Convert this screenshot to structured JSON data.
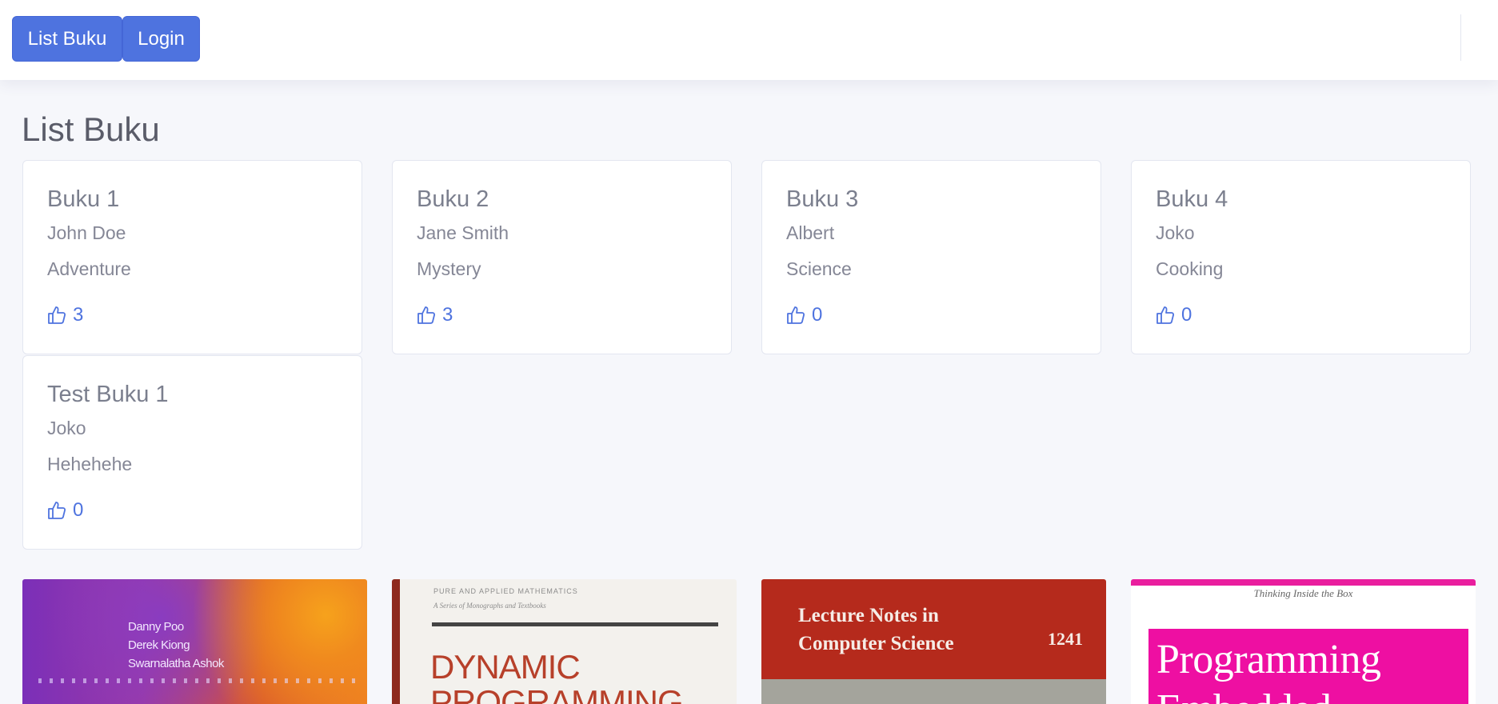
{
  "navbar": {
    "list_buku_label": "List Buku",
    "login_label": "Login"
  },
  "page": {
    "title": "List Buku"
  },
  "books": [
    {
      "title": "Buku 1",
      "author": "John Doe",
      "genre": "Adventure",
      "likes": "3"
    },
    {
      "title": "Buku 2",
      "author": "Jane Smith",
      "genre": "Mystery",
      "likes": "3"
    },
    {
      "title": "Buku 3",
      "author": "Albert",
      "genre": "Science",
      "likes": "0"
    },
    {
      "title": "Buku 4",
      "author": "Joko",
      "genre": "Cooking",
      "likes": "0"
    },
    {
      "title": "Test Buku 1",
      "author": "Joko",
      "genre": "Hehehehe",
      "likes": "0"
    }
  ],
  "covers": [
    {
      "authors": [
        "Danny Poo",
        "Derek Kiong",
        "Swarnalatha Ashok"
      ]
    },
    {
      "series_line": "PURE AND APPLIED MATHEMATICS",
      "subtitle": "A Series of Monographs and Textbooks",
      "title": "DYNAMIC PROGRAMMING"
    },
    {
      "title_line1": "Lecture Notes in",
      "title_line2": "Computer Science",
      "volume": "1241"
    },
    {
      "tagline": "Thinking Inside the Box",
      "title": "Programming Embedded"
    }
  ],
  "colors": {
    "primary": "#4e73df",
    "background": "#f6f7fb"
  },
  "icons": {
    "like": "thumbs-up-icon"
  }
}
